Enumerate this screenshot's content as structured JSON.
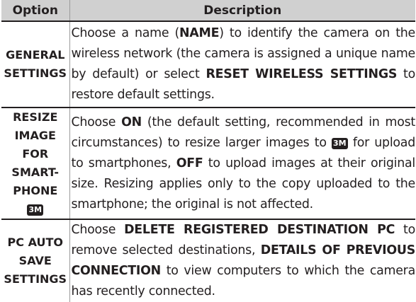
{
  "table": {
    "header_option": "Option",
    "header_description": "Description",
    "rows": [
      {
        "option_lines": [
          "GENERAL",
          "SETTINGS"
        ],
        "desc": {
          "p1": "Choose a name (",
          "b1": "NAME",
          "p2": ") to identify the camera on the wireless network (the camera is assigned a unique name by default) or select ",
          "b2": "RESET WIRELESS SET­TINGS",
          "p3": " to restore default settings."
        }
      },
      {
        "option_lines": [
          "RESIZE",
          "IMAGE FOR",
          "SMART-",
          "PHONE"
        ],
        "option_badge": "3M",
        "desc": {
          "p1": "Choose ",
          "b1": "ON",
          "p2": " (the default setting, recommended in most circumstances) to resize larger images to ",
          "badge": "3M",
          "p3": " for upload to smartphones, ",
          "b2": "OFF",
          "p4": " to upload images at their original size.  Resizing applies only to the copy uploaded to the smartphone; the original is not affected."
        }
      },
      {
        "option_lines": [
          "PC AUTO",
          "SAVE",
          "SETTINGS"
        ],
        "desc": {
          "p1": "Choose ",
          "b1": "DELETE REGISTERED DESTINATION PC",
          "p2": " to remove selected destinations, ",
          "b2": "DETAILS OF PREVI­OUS CONNECTION",
          "p3": " to view computers to which the camera has recently connected."
        }
      }
    ]
  }
}
